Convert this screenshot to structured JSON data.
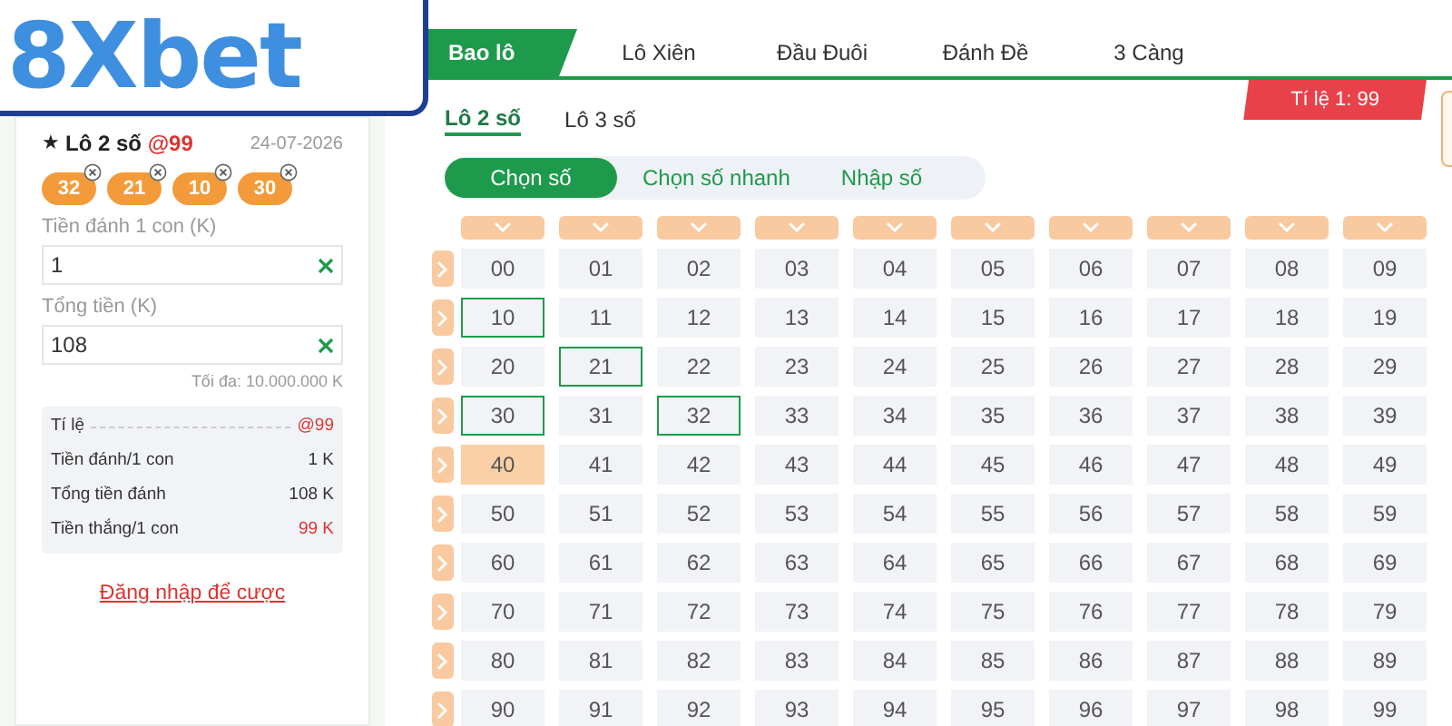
{
  "logo": "8Xbet",
  "slip": {
    "star": "★",
    "title": "Lô 2 số",
    "odds": "@99",
    "date": "24-07-2026",
    "balls": [
      "32",
      "21",
      "10",
      "30"
    ],
    "fields": [
      {
        "label": "Tiền đánh 1 con (K)",
        "value": "1"
      },
      {
        "label": "Tổng tiền (K)",
        "value": "108"
      }
    ],
    "max_note": "Tối đa: 10.000.000 K",
    "summary": [
      {
        "label": "Tí lệ",
        "value": "@99",
        "kind": "odds"
      },
      {
        "label": "Tiền đánh/1 con",
        "value": "1 K",
        "kind": "plain"
      },
      {
        "label": "Tổng tiền đánh",
        "value": "108 K",
        "kind": "plain"
      },
      {
        "label": "Tiền thắng/1 con",
        "value": "99 K",
        "kind": "win"
      }
    ],
    "login_link": "Đăng nhập để cược"
  },
  "tabs": [
    {
      "label": "Bao lô",
      "selected": true
    },
    {
      "label": "Lô Xiên",
      "selected": false
    },
    {
      "label": "Đầu Đuôi",
      "selected": false
    },
    {
      "label": "Đánh Đề",
      "selected": false
    },
    {
      "label": "3 Càng",
      "selected": false
    }
  ],
  "subtabs": [
    {
      "label": "Lô 2 số",
      "selected": true
    },
    {
      "label": "Lô 3 số",
      "selected": false
    }
  ],
  "rate_badge": "Tí lệ 1: 99",
  "modes": [
    {
      "label": "Chọn số",
      "selected": true
    },
    {
      "label": "Chọn số nhanh",
      "selected": false
    },
    {
      "label": "Nhập số",
      "selected": false
    }
  ],
  "grid": [
    {
      "cells": [
        {
          "label": "00",
          "selected": false,
          "hovered": false
        },
        {
          "label": "01",
          "selected": false,
          "hovered": false
        },
        {
          "label": "02",
          "selected": false,
          "hovered": false
        },
        {
          "label": "03",
          "selected": false,
          "hovered": false
        },
        {
          "label": "04",
          "selected": false,
          "hovered": false
        },
        {
          "label": "05",
          "selected": false,
          "hovered": false
        },
        {
          "label": "06",
          "selected": false,
          "hovered": false
        },
        {
          "label": "07",
          "selected": false,
          "hovered": false
        },
        {
          "label": "08",
          "selected": false,
          "hovered": false
        },
        {
          "label": "09",
          "selected": false,
          "hovered": false
        }
      ]
    },
    {
      "cells": [
        {
          "label": "10",
          "selected": true,
          "hovered": false
        },
        {
          "label": "11",
          "selected": false,
          "hovered": false
        },
        {
          "label": "12",
          "selected": false,
          "hovered": false
        },
        {
          "label": "13",
          "selected": false,
          "hovered": false
        },
        {
          "label": "14",
          "selected": false,
          "hovered": false
        },
        {
          "label": "15",
          "selected": false,
          "hovered": false
        },
        {
          "label": "16",
          "selected": false,
          "hovered": false
        },
        {
          "label": "17",
          "selected": false,
          "hovered": false
        },
        {
          "label": "18",
          "selected": false,
          "hovered": false
        },
        {
          "label": "19",
          "selected": false,
          "hovered": false
        }
      ]
    },
    {
      "cells": [
        {
          "label": "20",
          "selected": false,
          "hovered": false
        },
        {
          "label": "21",
          "selected": true,
          "hovered": false
        },
        {
          "label": "22",
          "selected": false,
          "hovered": false
        },
        {
          "label": "23",
          "selected": false,
          "hovered": false
        },
        {
          "label": "24",
          "selected": false,
          "hovered": false
        },
        {
          "label": "25",
          "selected": false,
          "hovered": false
        },
        {
          "label": "26",
          "selected": false,
          "hovered": false
        },
        {
          "label": "27",
          "selected": false,
          "hovered": false
        },
        {
          "label": "28",
          "selected": false,
          "hovered": false
        },
        {
          "label": "29",
          "selected": false,
          "hovered": false
        }
      ]
    },
    {
      "cells": [
        {
          "label": "30",
          "selected": true,
          "hovered": false
        },
        {
          "label": "31",
          "selected": false,
          "hovered": false
        },
        {
          "label": "32",
          "selected": true,
          "hovered": false
        },
        {
          "label": "33",
          "selected": false,
          "hovered": false
        },
        {
          "label": "34",
          "selected": false,
          "hovered": false
        },
        {
          "label": "35",
          "selected": false,
          "hovered": false
        },
        {
          "label": "36",
          "selected": false,
          "hovered": false
        },
        {
          "label": "37",
          "selected": false,
          "hovered": false
        },
        {
          "label": "38",
          "selected": false,
          "hovered": false
        },
        {
          "label": "39",
          "selected": false,
          "hovered": false
        }
      ]
    },
    {
      "cells": [
        {
          "label": "40",
          "selected": false,
          "hovered": true
        },
        {
          "label": "41",
          "selected": false,
          "hovered": false
        },
        {
          "label": "42",
          "selected": false,
          "hovered": false
        },
        {
          "label": "43",
          "selected": false,
          "hovered": false
        },
        {
          "label": "44",
          "selected": false,
          "hovered": false
        },
        {
          "label": "45",
          "selected": false,
          "hovered": false
        },
        {
          "label": "46",
          "selected": false,
          "hovered": false
        },
        {
          "label": "47",
          "selected": false,
          "hovered": false
        },
        {
          "label": "48",
          "selected": false,
          "hovered": false
        },
        {
          "label": "49",
          "selected": false,
          "hovered": false
        }
      ]
    },
    {
      "cells": [
        {
          "label": "50",
          "selected": false,
          "hovered": false
        },
        {
          "label": "51",
          "selected": false,
          "hovered": false
        },
        {
          "label": "52",
          "selected": false,
          "hovered": false
        },
        {
          "label": "53",
          "selected": false,
          "hovered": false
        },
        {
          "label": "54",
          "selected": false,
          "hovered": false
        },
        {
          "label": "55",
          "selected": false,
          "hovered": false
        },
        {
          "label": "56",
          "selected": false,
          "hovered": false
        },
        {
          "label": "57",
          "selected": false,
          "hovered": false
        },
        {
          "label": "58",
          "selected": false,
          "hovered": false
        },
        {
          "label": "59",
          "selected": false,
          "hovered": false
        }
      ]
    },
    {
      "cells": [
        {
          "label": "60",
          "selected": false,
          "hovered": false
        },
        {
          "label": "61",
          "selected": false,
          "hovered": false
        },
        {
          "label": "62",
          "selected": false,
          "hovered": false
        },
        {
          "label": "63",
          "selected": false,
          "hovered": false
        },
        {
          "label": "64",
          "selected": false,
          "hovered": false
        },
        {
          "label": "65",
          "selected": false,
          "hovered": false
        },
        {
          "label": "66",
          "selected": false,
          "hovered": false
        },
        {
          "label": "67",
          "selected": false,
          "hovered": false
        },
        {
          "label": "68",
          "selected": false,
          "hovered": false
        },
        {
          "label": "69",
          "selected": false,
          "hovered": false
        }
      ]
    },
    {
      "cells": [
        {
          "label": "70",
          "selected": false,
          "hovered": false
        },
        {
          "label": "71",
          "selected": false,
          "hovered": false
        },
        {
          "label": "72",
          "selected": false,
          "hovered": false
        },
        {
          "label": "73",
          "selected": false,
          "hovered": false
        },
        {
          "label": "74",
          "selected": false,
          "hovered": false
        },
        {
          "label": "75",
          "selected": false,
          "hovered": false
        },
        {
          "label": "76",
          "selected": false,
          "hovered": false
        },
        {
          "label": "77",
          "selected": false,
          "hovered": false
        },
        {
          "label": "78",
          "selected": false,
          "hovered": false
        },
        {
          "label": "79",
          "selected": false,
          "hovered": false
        }
      ]
    },
    {
      "cells": [
        {
          "label": "80",
          "selected": false,
          "hovered": false
        },
        {
          "label": "81",
          "selected": false,
          "hovered": false
        },
        {
          "label": "82",
          "selected": false,
          "hovered": false
        },
        {
          "label": "83",
          "selected": false,
          "hovered": false
        },
        {
          "label": "84",
          "selected": false,
          "hovered": false
        },
        {
          "label": "85",
          "selected": false,
          "hovered": false
        },
        {
          "label": "86",
          "selected": false,
          "hovered": false
        },
        {
          "label": "87",
          "selected": false,
          "hovered": false
        },
        {
          "label": "88",
          "selected": false,
          "hovered": false
        },
        {
          "label": "89",
          "selected": false,
          "hovered": false
        }
      ]
    },
    {
      "cells": [
        {
          "label": "90",
          "selected": false,
          "hovered": false
        },
        {
          "label": "91",
          "selected": false,
          "hovered": false
        },
        {
          "label": "92",
          "selected": false,
          "hovered": false
        },
        {
          "label": "93",
          "selected": false,
          "hovered": false
        },
        {
          "label": "94",
          "selected": false,
          "hovered": false
        },
        {
          "label": "95",
          "selected": false,
          "hovered": false
        },
        {
          "label": "96",
          "selected": false,
          "hovered": false
        },
        {
          "label": "97",
          "selected": false,
          "hovered": false
        },
        {
          "label": "98",
          "selected": false,
          "hovered": false
        },
        {
          "label": "99",
          "selected": false,
          "hovered": false
        }
      ]
    }
  ]
}
